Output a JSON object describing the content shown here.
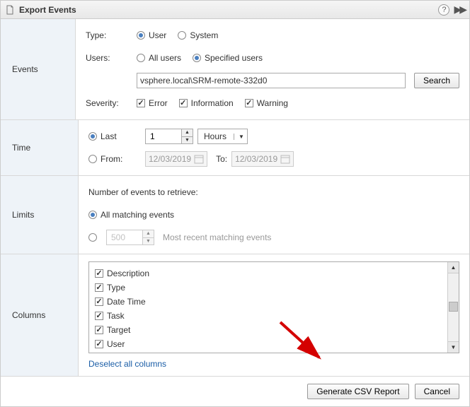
{
  "title": "Export Events",
  "sections": {
    "events": {
      "label": "Events",
      "type_label": "Type:",
      "type_options": {
        "user": "User",
        "system": "System"
      },
      "type_selected": "user",
      "users_label": "Users:",
      "users_options": {
        "all": "All users",
        "specified": "Specified users"
      },
      "users_selected": "specified",
      "search_value": "vsphere.local\\SRM-remote-332d0",
      "search_button": "Search",
      "severity_label": "Severity:",
      "severity": [
        {
          "key": "error",
          "label": "Error",
          "checked": true
        },
        {
          "key": "info",
          "label": "Information",
          "checked": true
        },
        {
          "key": "warning",
          "label": "Warning",
          "checked": true
        }
      ]
    },
    "time": {
      "label": "Time",
      "mode_selected": "last",
      "last_label": "Last",
      "last_value": "1",
      "last_unit": "Hours",
      "from_label": "From:",
      "from_value": "12/03/2019",
      "to_label": "To:",
      "to_value": "12/03/2019"
    },
    "limits": {
      "label": "Limits",
      "heading": "Number of events to retrieve:",
      "mode_selected": "all",
      "all_label": "All matching events",
      "count_value": "500",
      "count_hint": "Most recent matching events"
    },
    "columns": {
      "label": "Columns",
      "items": [
        {
          "key": "description",
          "label": "Description",
          "checked": true
        },
        {
          "key": "type",
          "label": "Type",
          "checked": true
        },
        {
          "key": "datetime",
          "label": "Date Time",
          "checked": true
        },
        {
          "key": "task",
          "label": "Task",
          "checked": true
        },
        {
          "key": "target",
          "label": "Target",
          "checked": true
        },
        {
          "key": "user",
          "label": "User",
          "checked": true
        }
      ],
      "deselect_label": "Deselect all columns"
    }
  },
  "footer": {
    "generate": "Generate CSV Report",
    "cancel": "Cancel"
  }
}
